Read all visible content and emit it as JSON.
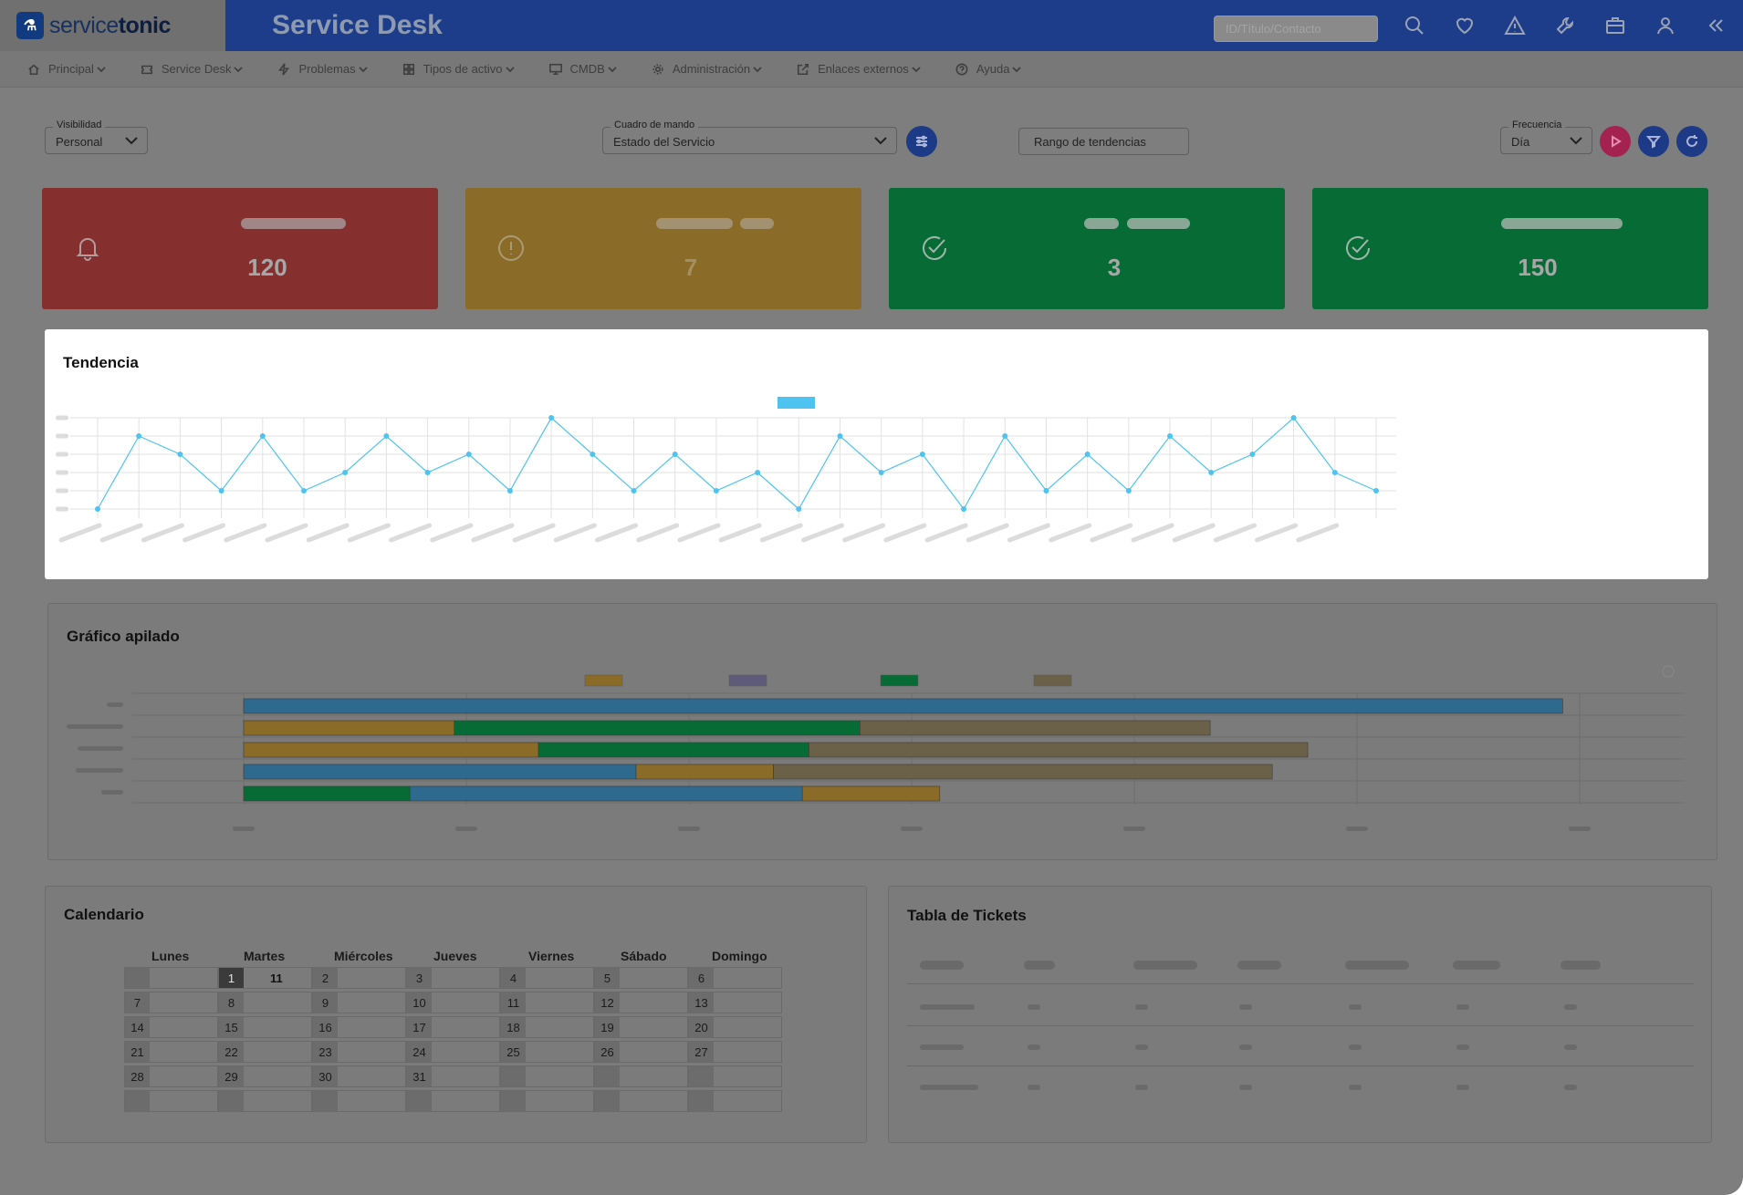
{
  "brand": {
    "badge": "⚗",
    "name_prefix": "service",
    "name_suffix": "tonic"
  },
  "header": {
    "title": "Service Desk",
    "search_placeholder": "ID/Título/Contacto",
    "icons": [
      "search-icon",
      "heart-icon",
      "warning-icon",
      "wrench-icon",
      "briefcase-icon",
      "user-icon",
      "collapse-icon"
    ]
  },
  "nav": {
    "items": [
      {
        "label": "Principal",
        "icon": "home-icon"
      },
      {
        "label": "Service Desk",
        "icon": "ticket-icon"
      },
      {
        "label": "Problemas",
        "icon": "bolt-icon"
      },
      {
        "label": "Tipos de activo",
        "icon": "grid-icon"
      },
      {
        "label": "CMDB",
        "icon": "monitor-icon"
      },
      {
        "label": "Administración",
        "icon": "gear-icon"
      },
      {
        "label": "Enlaces externos",
        "icon": "external-link-icon"
      },
      {
        "label": "Ayuda",
        "icon": "help-icon"
      }
    ]
  },
  "filters": {
    "visibility": {
      "label": "Visibilidad",
      "value": "Personal"
    },
    "dashboard": {
      "label": "Cuadro de mando",
      "value": "Estado del Servicio"
    },
    "trend_range": {
      "label": "Rango de tendencias"
    },
    "frequency": {
      "label": "Frecuencia",
      "value": "Día"
    },
    "accent_colors": {
      "play": "#a3224f",
      "filter": "#1c3a86",
      "refresh": "#1c3a86",
      "settings": "#1c3a86"
    }
  },
  "kpis": [
    {
      "value": "120",
      "icon": "bell-icon",
      "color": "#862f2f",
      "text_color": "#a7a7a7"
    },
    {
      "value": "7",
      "icon": "alert-circle-icon",
      "color": "#8a6b27",
      "text_color": "#a58f5f"
    },
    {
      "value": "3",
      "icon": "check-circle-icon",
      "color": "#076b35",
      "text_color": "#a7a7a7"
    },
    {
      "value": "150",
      "icon": "check-circle-icon",
      "color": "#076b35",
      "text_color": "#a7a7a7"
    }
  ],
  "trend": {
    "title": "Tendencia",
    "chart_data": {
      "type": "line",
      "series_color": "#4fc3f0",
      "values": [
        0,
        4,
        3,
        1,
        4,
        1,
        2,
        4,
        2,
        3,
        1,
        5,
        3,
        1,
        3,
        1,
        2,
        0,
        4,
        2,
        3,
        0,
        4,
        1,
        3,
        1,
        4,
        2,
        3,
        5,
        2,
        1
      ],
      "ylim": [
        0,
        5
      ]
    }
  },
  "stacked": {
    "title": "Gráfico apilado",
    "chart_data": {
      "type": "bar",
      "orientation": "horizontal",
      "stacked": true,
      "colors": [
        "#2e6a8e",
        "#8a6b27",
        "#076b35",
        "#5e5b7a",
        "#6b6149"
      ],
      "legend_colors": [
        "#8a6b27",
        "#5e5b7a",
        "#076b35",
        "#6b6149"
      ],
      "xlim": [
        0,
        650
      ],
      "rows": [
        [
          {
            "c": 0,
            "v": 595
          }
        ],
        [
          {
            "c": 1,
            "v": 95
          },
          {
            "c": 2,
            "v": 183
          },
          {
            "c": 4,
            "v": 158
          }
        ],
        [
          {
            "c": 1,
            "v": 133
          },
          {
            "c": 2,
            "v": 122
          },
          {
            "c": 4,
            "v": 225
          }
        ],
        [
          {
            "c": 0,
            "v": 177
          },
          {
            "c": 1,
            "v": 62
          },
          {
            "c": 4,
            "v": 225
          }
        ],
        [
          {
            "c": 2,
            "v": 75
          },
          {
            "c": 0,
            "v": 177
          },
          {
            "c": 1,
            "v": 62
          }
        ]
      ]
    }
  },
  "calendar": {
    "title": "Calendario",
    "days": [
      "Lunes",
      "Martes",
      "Miércoles",
      "Jueves",
      "Viernes",
      "Sábado",
      "Domingo"
    ],
    "weeks": [
      [
        "",
        "1",
        "2",
        "3",
        "4",
        "5",
        "6"
      ],
      [
        "7",
        "8",
        "9",
        "10",
        "11",
        "12",
        "13"
      ],
      [
        "14",
        "15",
        "16",
        "17",
        "18",
        "19",
        "20"
      ],
      [
        "21",
        "22",
        "23",
        "24",
        "25",
        "26",
        "27"
      ],
      [
        "28",
        "29",
        "30",
        "31",
        "",
        "",
        ""
      ],
      [
        "",
        "",
        "",
        "",
        "",
        "",
        ""
      ]
    ],
    "today": "1",
    "today_count": "11"
  },
  "tickets": {
    "title": "Tabla de Tickets"
  }
}
